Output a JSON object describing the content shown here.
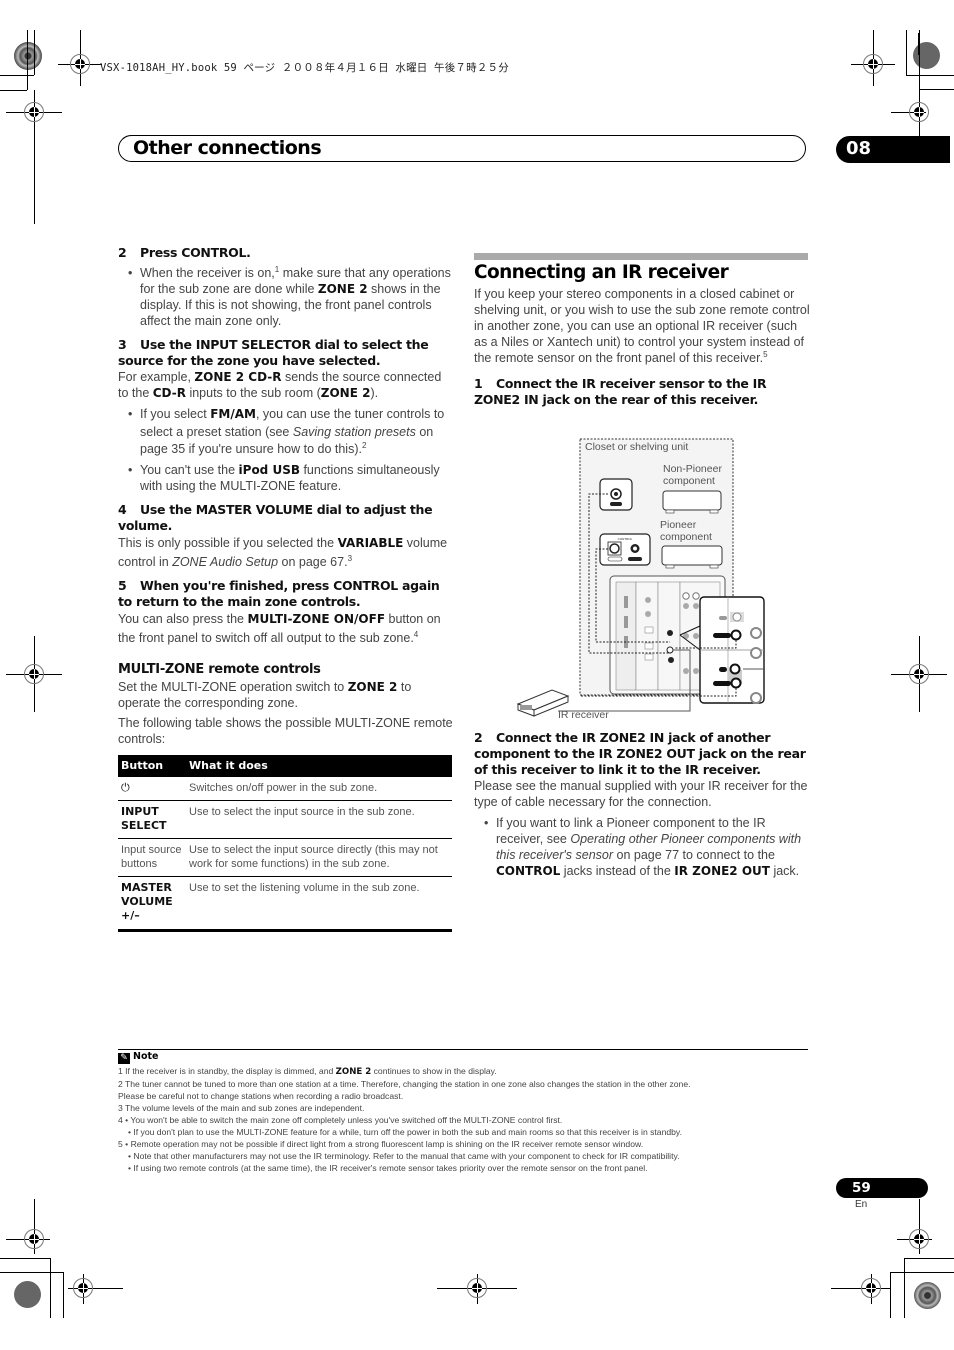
{
  "print_header": "VSX-1018AH_HY.book  59 ページ  ２００８年４月１６日  水曜日  午後７時２５分",
  "chapter": {
    "title": "Other connections",
    "number": "08"
  },
  "left_column": {
    "step2": {
      "num": "2",
      "title": "Press CONTROL."
    },
    "step2_bullet": {
      "t1": "When the receiver is on,",
      "sup": "1",
      "t2": " make sure that any operations for the sub zone are done while ",
      "b1": "ZONE 2",
      "t3": " shows in the display. If this is not showing, the front panel controls affect the main zone only."
    },
    "step3": {
      "num": "3",
      "title": "Use the INPUT SELECTOR dial to select the source for the zone you have selected."
    },
    "step3_body": {
      "t1": "For example, ",
      "b1": "ZONE 2 CD-R",
      "t2": " sends the source connected to the ",
      "b2": "CD-R",
      "t3": " inputs to the sub room (",
      "b3": "ZONE 2",
      "t4": ")."
    },
    "step3_bullet1": {
      "t1": "If you select ",
      "b1": "FM/AM",
      "t2": ", you can use the tuner controls to select a preset station (see ",
      "i1": "Saving station presets",
      "t3": " on page 35 if you're unsure how to do this).",
      "sup": "2"
    },
    "step3_bullet2": {
      "t1": "You can't use the ",
      "b1": "iPod USB",
      "t2": " functions simultaneously with using the MULTI-ZONE feature."
    },
    "step4": {
      "num": "4",
      "title": "Use the MASTER VOLUME dial to adjust the volume."
    },
    "step4_body": {
      "t1": "This is only possible if you selected the ",
      "b1": "VARIABLE",
      "t2": " volume control in ",
      "i1": "ZONE Audio Setup",
      "t3": " on page 67.",
      "sup": "3"
    },
    "step5": {
      "num": "5",
      "title": "When you're finished, press CONTROL again to return to the main zone controls."
    },
    "step5_body": {
      "t1": "You can also press the ",
      "b1": "MULTI-ZONE ON/OFF",
      "t2": " button on the front panel to switch off all output to the sub zone.",
      "sup": "4"
    },
    "subhead": "MULTI-ZONE remote controls",
    "sub_p1": {
      "t1": "Set the MULTI-ZONE operation switch to ",
      "b1": "ZONE 2",
      "t2": " to operate the corresponding zone."
    },
    "sub_p2": "The following table shows the possible MULTI-ZONE remote controls:",
    "table": {
      "headers": [
        "Button",
        "What it does"
      ],
      "rows": [
        {
          "button": "⏻",
          "button_icon": "power-icon",
          "desc": "Switches on/off power in the sub zone."
        },
        {
          "button": "INPUT SELECT",
          "desc": "Use to select the input source in the sub zone."
        },
        {
          "button": "Input source buttons",
          "desc": "Use to select the input source directly (this may not work for some functions) in the sub zone."
        },
        {
          "button": "MASTER VOLUME +/–",
          "desc": "Use to set the listening volume in the sub zone."
        }
      ]
    }
  },
  "right_column": {
    "section_title": "Connecting an IR receiver",
    "intro": {
      "t1": "If you keep your stereo components in a closed cabinet or shelving unit, or you wish to use the sub zone remote control in another zone, you can use an optional IR receiver (such as a Niles or Xantech unit) to control your system instead of the remote sensor on the front panel of this receiver.",
      "sup": "5"
    },
    "step1": {
      "num": "1",
      "title": "Connect the IR receiver sensor to the IR ZONE2 IN jack on the rear of this receiver."
    },
    "diagram": {
      "closet_label": "Closet or shelving unit",
      "non_pioneer_label": "Non-Pioneer component",
      "pioneer_label": "Pioneer component",
      "ir_receiver_label": "IR receiver",
      "control_label": "CONTROL"
    },
    "step2": {
      "num": "2",
      "title": "Connect the IR ZONE2 IN jack of another component to the IR ZONE2 OUT jack on the rear of this receiver to link it to the IR receiver."
    },
    "step2_body": "Please see the manual supplied with your IR receiver for the type of cable necessary for the connection.",
    "step2_bullet": {
      "t1": "If you want to link a Pioneer component to the IR receiver, see ",
      "i1": "Operating other Pioneer components with this receiver's sensor",
      "t2": " on page 77 to connect to the ",
      "b1": "CONTROL",
      "t3": " jacks instead of the ",
      "b2": "IR ZONE2 OUT",
      "t4": " jack."
    }
  },
  "notes": {
    "heading": "Note",
    "n1": {
      "t1": "1 If the receiver is in standby, the display is dimmed, and ",
      "b1": "ZONE 2",
      "t2": " continues to show in the display."
    },
    "lines": [
      "2 The tuner cannot be tuned to more than one station at a time. Therefore, changing the station in one zone also changes the station in the other zone.",
      "Please be careful not to change stations when recording a radio broadcast.",
      "3 The volume levels of the main and sub zones are independent.",
      "4 • You won't be able to switch the main zone off completely unless you've switched off the MULTI-ZONE control first.",
      "   • If you don't plan to use the MULTI-ZONE feature for a while, turn off the power in both the sub and main rooms so that this receiver is in standby.",
      "5 • Remote operation may not be possible if direct light from a strong fluorescent lamp is shining on the IR receiver remote sensor window.",
      "   • Note that other manufacturers may not use the IR terminology. Refer to the manual that came with your component to check for IR compatibility.",
      "   • If using two remote controls (at the same time), the IR receiver's remote sensor takes priority over the remote sensor on the front panel."
    ]
  },
  "footer": {
    "page_number": "59",
    "language": "En"
  }
}
